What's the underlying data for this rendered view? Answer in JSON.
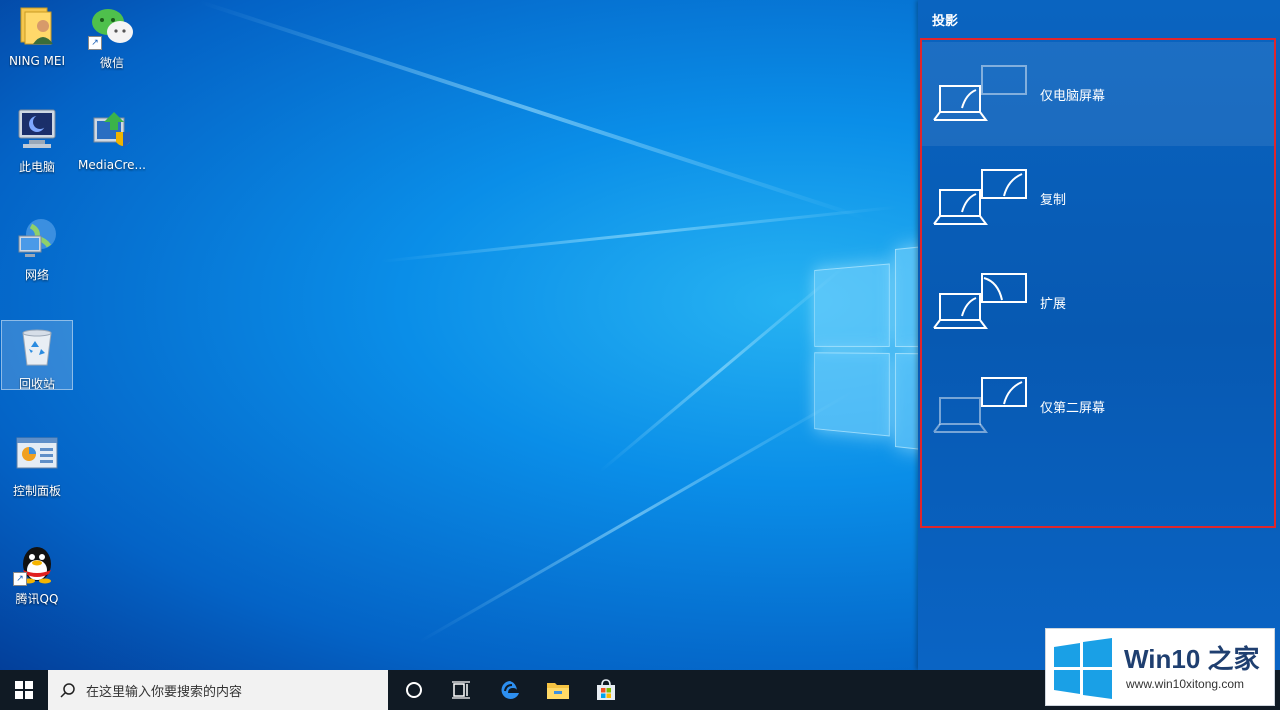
{
  "desktop": {
    "icons": [
      {
        "label": "NING MEI",
        "icon": "user-folder-icon"
      },
      {
        "label": "微信",
        "icon": "wechat-icon"
      },
      {
        "label": "此电脑",
        "icon": "this-pc-icon"
      },
      {
        "label": "MediaCre...",
        "icon": "media-creation-tool-icon"
      },
      {
        "label": "网络",
        "icon": "network-icon"
      },
      {
        "label": "回收站",
        "icon": "recycle-bin-icon"
      },
      {
        "label": "控制面板",
        "icon": "control-panel-icon"
      },
      {
        "label": "腾讯QQ",
        "icon": "qq-icon"
      }
    ]
  },
  "project_panel": {
    "title": "投影",
    "options": [
      {
        "label": "仅电脑屏幕",
        "icon": "pc-screen-only-icon",
        "selected": true
      },
      {
        "label": "复制",
        "icon": "duplicate-icon",
        "selected": false
      },
      {
        "label": "扩展",
        "icon": "extend-icon",
        "selected": false
      },
      {
        "label": "仅第二屏幕",
        "icon": "second-screen-only-icon",
        "selected": false
      }
    ],
    "highlight_color": "#e0262c"
  },
  "taskbar": {
    "search_placeholder": "在这里输入你要搜索的内容",
    "items": [
      "start-icon",
      "cortana-icon",
      "task-view-icon",
      "edge-icon",
      "file-explorer-icon",
      "store-icon"
    ]
  },
  "watermark": {
    "title": "Win10 之家",
    "url": "www.win10xitong.com"
  }
}
